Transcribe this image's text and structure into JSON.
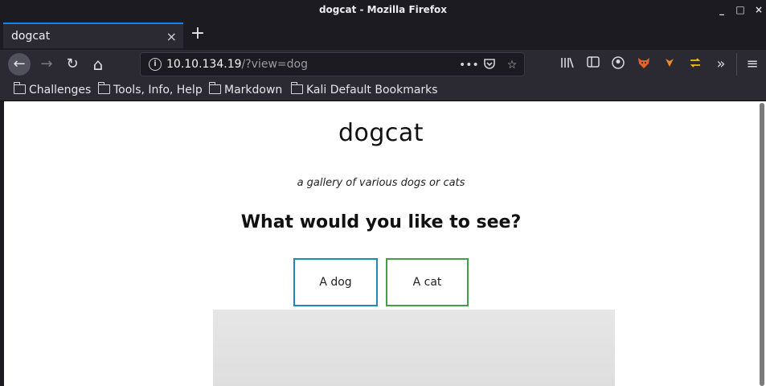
{
  "window": {
    "title": "dogcat - Mozilla Firefox",
    "controls": [
      "_",
      "□",
      "×"
    ]
  },
  "tabs": [
    {
      "label": "dogcat",
      "close": "×"
    }
  ],
  "new_tab": "+",
  "nav": {
    "back": "←",
    "forward": "→",
    "reload": "↻",
    "home": "⌂"
  },
  "urlbar": {
    "host": "10.10.134.19",
    "path": "/?view=dog",
    "page_actions": "•••"
  },
  "bookmarks": [
    "Challenges",
    "Tools, Info, Help",
    "Markdown",
    "Kali Default Bookmarks"
  ],
  "page": {
    "title": "dogcat",
    "subtitle": "a gallery of various dogs or cats",
    "question": "What would you like to see?",
    "buttons": {
      "dog": "A dog",
      "cat": "A cat"
    }
  },
  "colors": {
    "accent": "#0a84ff",
    "dog_border": "#1e88b8",
    "cat_border": "#43a047"
  }
}
